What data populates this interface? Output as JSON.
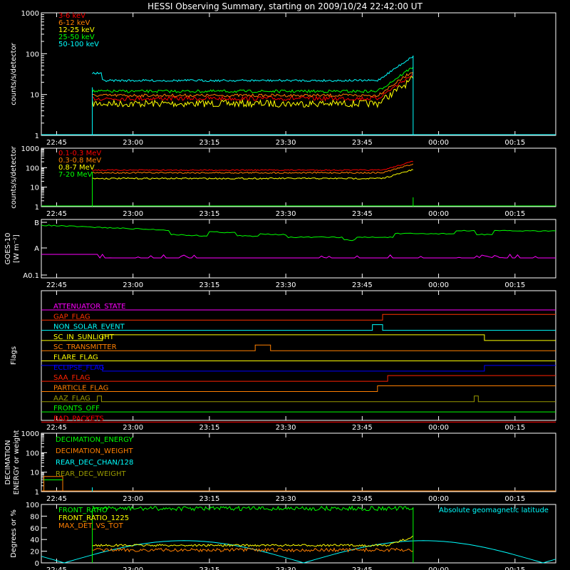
{
  "title": "HESSI Observing Summary, starting on 2009/10/24 22:42:00 UT",
  "x_ticks": [
    "22:45",
    "23:00",
    "23:15",
    "23:30",
    "23:45",
    "00:00",
    "00:15"
  ],
  "chart_data": [
    {
      "id": "hxr",
      "type": "line",
      "ylabel": "counts/s/detector",
      "yscale": "log",
      "ylim": [
        1,
        1000
      ],
      "yticks": [
        "1",
        "10",
        "100",
        "1000"
      ],
      "series": [
        {
          "name": "3-6 keV",
          "color": "#ff0000"
        },
        {
          "name": "6-12 keV",
          "color": "#ff7f00"
        },
        {
          "name": "12-25 keV",
          "color": "#ffff00"
        },
        {
          "name": "25-50 keV",
          "color": "#00ff00"
        },
        {
          "name": "50-100 keV",
          "color": "#00ffff"
        }
      ]
    },
    {
      "id": "gamma",
      "type": "line",
      "ylabel": "counts/s/detector",
      "yscale": "log",
      "ylim": [
        1,
        1000
      ],
      "yticks": [
        "1",
        "10",
        "100",
        "1000"
      ],
      "series": [
        {
          "name": "0.1-0.3 MeV",
          "color": "#ff0000"
        },
        {
          "name": "0.3-0.8 MeV",
          "color": "#ff7f00"
        },
        {
          "name": "0.8-7 MeV",
          "color": "#ffff00"
        },
        {
          "name": "7-20 MeV",
          "color": "#00ff00"
        }
      ]
    },
    {
      "id": "goes",
      "type": "line",
      "ylabel": "GOES-10",
      "ylabel2": "[W m⁻²]",
      "yticks": [
        "B",
        "A",
        "A0.1"
      ],
      "series": [
        {
          "name": "",
          "color": "#00ff00"
        },
        {
          "name": "",
          "color": "#ff00ff"
        }
      ]
    },
    {
      "id": "flags",
      "type": "line",
      "ylabel": "Flags",
      "series": [
        {
          "name": "ATTENUATOR_STATE",
          "color": "#ff00ff"
        },
        {
          "name": "GAP_FLAG",
          "color": "#ff3300"
        },
        {
          "name": "NON_SOLAR_EVENT",
          "color": "#00ffff"
        },
        {
          "name": "SC_IN_SUNLIGHT",
          "color": "#ffff00"
        },
        {
          "name": "SC_TRANSMITTER",
          "color": "#ff7f00"
        },
        {
          "name": "FLARE_FLAG",
          "color": "#ffff00"
        },
        {
          "name": "ECLIPSE_FLAG",
          "color": "#0000ff"
        },
        {
          "name": "SAA_FLAG",
          "color": "#ff2200"
        },
        {
          "name": "PARTICLE_FLAG",
          "color": "#ff7f00"
        },
        {
          "name": "AAZ_FLAG",
          "color": "#999900"
        },
        {
          "name": "FRONTS_OFF",
          "color": "#00ff00"
        },
        {
          "name": "BAD_PACKETS",
          "color": "#ff0000"
        }
      ]
    },
    {
      "id": "decimation",
      "type": "line",
      "ylabel": "DECIMATION",
      "ylabel2": "ENERGY or weight",
      "yscale": "log",
      "ylim": [
        1,
        1000
      ],
      "yticks": [
        "1",
        "10",
        "100",
        "1000"
      ],
      "series": [
        {
          "name": "DECIMATION_ENERGY",
          "color": "#00ff00"
        },
        {
          "name": "DECIMATION_WEIGHT",
          "color": "#ff7f00"
        },
        {
          "name": "REAR_DEC_CHAN/128",
          "color": "#00ffff"
        },
        {
          "name": "REAR_DEC_WEIGHT",
          "color": "#999900"
        }
      ]
    },
    {
      "id": "ratios",
      "type": "line",
      "ylabel": "Degrees or %",
      "ylim": [
        0,
        100
      ],
      "yticks": [
        "0",
        "20",
        "40",
        "60",
        "80",
        "100"
      ],
      "series": [
        {
          "name": "FRONT_RATIO",
          "color": "#00ff00"
        },
        {
          "name": "FRONT_RATIO_1225",
          "color": "#ffff00"
        },
        {
          "name": "MAX_DET_VS_TOT",
          "color": "#ff7f00"
        },
        {
          "name": "Absolute geomagnetic latitude",
          "color": "#00ffff"
        }
      ]
    }
  ]
}
